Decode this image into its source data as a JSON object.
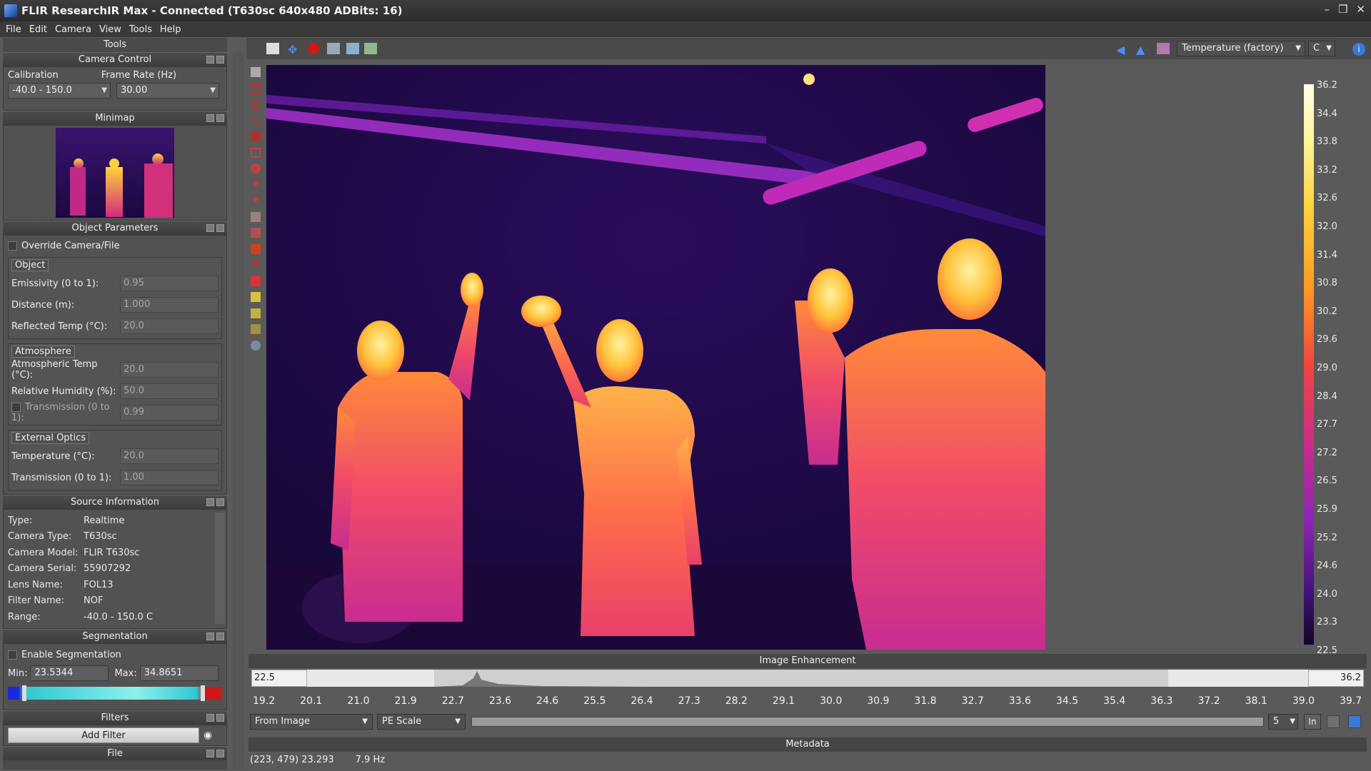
{
  "window": {
    "title": "FLIR ResearchIR Max - Connected (T630sc 640x480 ADBits: 16)"
  },
  "menu": [
    "File",
    "Edit",
    "Camera",
    "View",
    "Tools",
    "Help"
  ],
  "tools_title": "Tools",
  "camera_control": {
    "title": "Camera Control",
    "calibration_label": "Calibration",
    "calibration_value": "-40.0 - 150.0",
    "frame_rate_label": "Frame Rate (Hz)",
    "frame_rate_value": "30.00"
  },
  "minimap": {
    "title": "Minimap"
  },
  "object_parameters": {
    "title": "Object Parameters",
    "override_label": "Override Camera/File",
    "object_group": "Object",
    "emissivity_label": "Emissivity (0 to 1):",
    "emissivity": "0.95",
    "distance_label": "Distance (m):",
    "distance": "1.000",
    "reflected_label": "Reflected Temp (°C):",
    "reflected": "20.0",
    "atmosphere_group": "Atmosphere",
    "atm_temp_label": "Atmospheric Temp (°C):",
    "atm_temp": "20.0",
    "humidity_label": "Relative Humidity (%):",
    "humidity": "50.0",
    "transmission_label": "Transmission (0 to 1):",
    "transmission": "0.99",
    "optics_group": "External Optics",
    "optics_temp_label": "Temperature (°C):",
    "optics_temp": "20.0",
    "optics_trans_label": "Transmission (0 to 1):",
    "optics_trans": "1.00"
  },
  "source_information": {
    "title": "Source Information",
    "rows": [
      {
        "k": "Type:",
        "v": "Realtime"
      },
      {
        "k": "Camera Type:",
        "v": "T630sc"
      },
      {
        "k": "Camera Model:",
        "v": "FLIR T630sc"
      },
      {
        "k": "Camera Serial:",
        "v": "55907292"
      },
      {
        "k": "Lens Name:",
        "v": "FOL13"
      },
      {
        "k": "Filter Name:",
        "v": "NOF"
      },
      {
        "k": "Range:",
        "v": "-40.0 - 150.0 C"
      }
    ]
  },
  "segmentation": {
    "title": "Segmentation",
    "enable_label": "Enable Segmentation",
    "min_label": "Min:",
    "min": "23.5344",
    "max_label": "Max:",
    "max": "34.8651"
  },
  "filters": {
    "title": "Filters",
    "add_label": "Add Filter"
  },
  "file_panel": {
    "title": "File"
  },
  "toolbar": {
    "measurement": "Temperature (factory)",
    "unit": "C"
  },
  "colorbar": {
    "labels": [
      "36.2",
      "34.4",
      "33.8",
      "33.2",
      "32.6",
      "32.0",
      "31.4",
      "30.8",
      "30.2",
      "29.6",
      "29.0",
      "28.4",
      "27.7",
      "27.2",
      "26.5",
      "25.9",
      "25.2",
      "24.6",
      "24.0",
      "23.3",
      "22.5"
    ]
  },
  "image_enhancement": {
    "title": "Image Enhancement",
    "low": "22.5",
    "high": "36.2",
    "ticks": [
      "19.2",
      "20.1",
      "21.0",
      "21.9",
      "22.7",
      "23.6",
      "24.6",
      "25.5",
      "26.4",
      "27.3",
      "28.2",
      "29.1",
      "30.0",
      "30.9",
      "31.8",
      "32.7",
      "33.6",
      "34.5",
      "35.4",
      "36.3",
      "37.2",
      "38.1",
      "39.0",
      "39.7"
    ],
    "source": "From Image",
    "scale": "PE Scale",
    "step": "5",
    "in_label": "In"
  },
  "metadata": {
    "title": "Metadata"
  },
  "status": {
    "cursor": "(223, 479) 23.293",
    "rate": "7.9 Hz"
  }
}
